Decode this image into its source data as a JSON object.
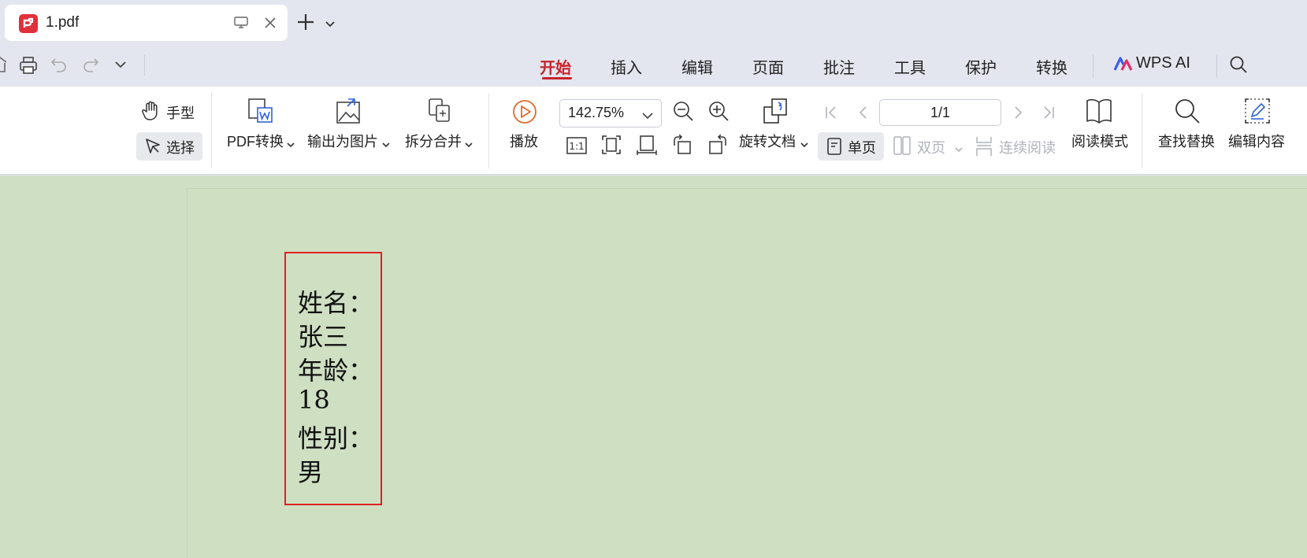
{
  "tab": {
    "title": "1.pdf"
  },
  "menu": {
    "items": [
      "开始",
      "插入",
      "编辑",
      "页面",
      "批注",
      "工具",
      "保护",
      "转换"
    ],
    "wps_ai": "WPS AI"
  },
  "ribbon": {
    "hand": "手型",
    "select": "选择",
    "pdf_convert": "PDF转换",
    "export_image": "输出为图片",
    "split_merge": "拆分合并",
    "play": "播放",
    "zoom": "142.75%",
    "rotate_doc": "旋转文档",
    "single_page": "单页",
    "double_page": "双页",
    "continuous": "连续阅读",
    "page_indicator": "1/1",
    "read_mode": "阅读模式",
    "find_replace": "查找替换",
    "edit_content": "编辑内容",
    "ratio_label": "1:1"
  },
  "document": {
    "lines": [
      "姓名：",
      "张三",
      "年龄：",
      "18",
      "性别：",
      "男"
    ]
  },
  "colors": {
    "accent": "#c8232c",
    "doc_background": "#cfdfc4",
    "textbox_border": "#e02020"
  }
}
